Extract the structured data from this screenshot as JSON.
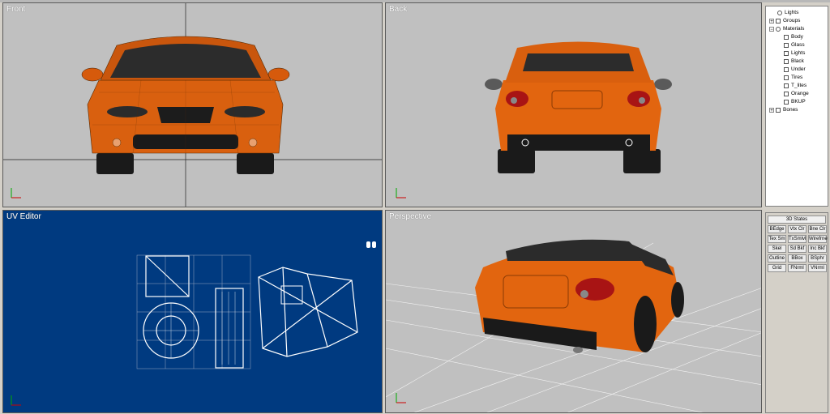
{
  "viewports": {
    "front": {
      "label": "Front"
    },
    "back": {
      "label": "Back"
    },
    "uv": {
      "label": "UV Editor"
    },
    "perspective": {
      "label": "Perspective"
    }
  },
  "tree": {
    "items": [
      {
        "label": "Lights"
      },
      {
        "label": "Groups"
      },
      {
        "label": "Materials"
      },
      {
        "label": "Body"
      },
      {
        "label": "Glass"
      },
      {
        "label": "Lights"
      },
      {
        "label": "Black"
      },
      {
        "label": "Under"
      },
      {
        "label": "Tires"
      },
      {
        "label": "T_lites"
      },
      {
        "label": "Orange"
      },
      {
        "label": "BKUP"
      },
      {
        "label": "Bones"
      }
    ]
  },
  "states_panel": {
    "title": "3D States",
    "buttons": [
      "BEdge",
      "Vtx Clr",
      "Bne Clr",
      "Tex Sm",
      "TxSmlvl",
      "Wirefrne",
      "Skel",
      "Sd Bkf",
      "Inc Bkf",
      "Outline",
      "BBox",
      "BSphr",
      "Grid",
      "FNrml",
      "VNrml"
    ]
  },
  "colors": {
    "car_orange": "#e0620f",
    "viewport_gray": "#c0c0c0",
    "uv_blue": "#003a80"
  }
}
